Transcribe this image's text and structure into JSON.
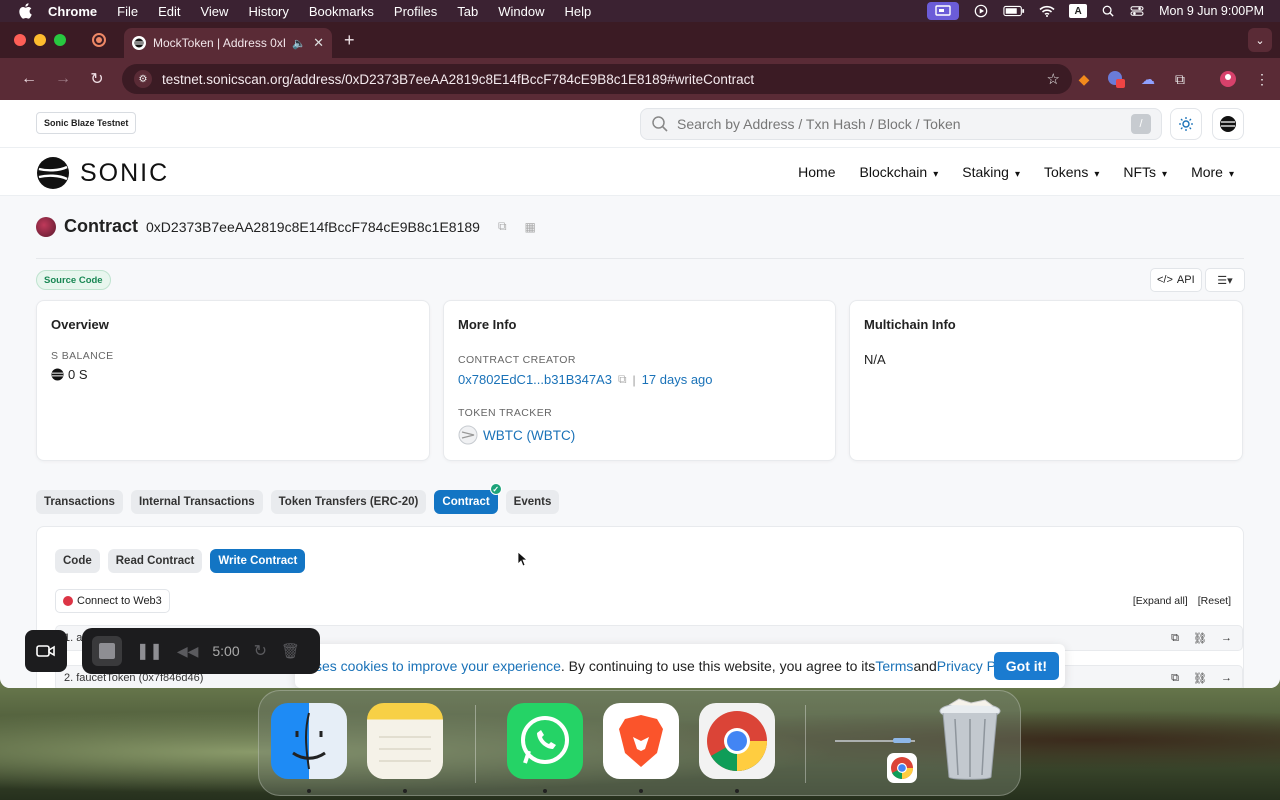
{
  "menubar": {
    "app": "Chrome",
    "items": [
      "File",
      "Edit",
      "View",
      "History",
      "Bookmarks",
      "Profiles",
      "Tab",
      "Window",
      "Help"
    ],
    "clock": "Mon 9 Jun  9:00PM",
    "input_source": "A"
  },
  "browser": {
    "tab_title": "MockToken | Address 0xD",
    "url": "testnet.sonicscan.org/address/0xD2373B7eeAA2819c8E14fBccF784cE9B8c1E8189#writeContract",
    "ext_badge": "1"
  },
  "site": {
    "network_badge": "Sonic Blaze Testnet",
    "search_placeholder": "Search by Address / Txn Hash / Block / Token",
    "search_shortcut": "/",
    "logo_text": "SONIC",
    "nav": [
      "Home",
      "Blockchain",
      "Staking",
      "Tokens",
      "NFTs",
      "More"
    ]
  },
  "contract": {
    "label": "Contract",
    "address": "0xD2373B7eeAA2819c8E14fBccF784cE9B8c1E8189",
    "source_badge": "Source Code",
    "api_label": "API"
  },
  "overview": {
    "title": "Overview",
    "balance_label": "S BALANCE",
    "balance_value": "0 S"
  },
  "more_info": {
    "title": "More Info",
    "creator_label": "CONTRACT CREATOR",
    "creator_addr": "0x7802EdC1...b31B347A3",
    "separator": "|",
    "creator_age": "17 days ago",
    "tracker_label": "TOKEN TRACKER",
    "tracker_value": "WBTC (WBTC)"
  },
  "multichain": {
    "title": "Multichain Info",
    "value": "N/A"
  },
  "tabs": [
    "Transactions",
    "Internal Transactions",
    "Token Transfers (ERC-20)",
    "Contract",
    "Events"
  ],
  "subtabs": [
    "Code",
    "Read Contract",
    "Write Contract"
  ],
  "write": {
    "connect_label": "Connect to Web3",
    "expand_all": "[Expand all]",
    "reset": "[Reset]",
    "row1_prefix": "1. a",
    "row2": "2. faucetToken (0x7f846d46)"
  },
  "cookie": {
    "text_1": "ses cookies to improve your experience",
    "text_2": ". By continuing to use this website, you agree to its ",
    "terms": "Terms",
    "and": " and ",
    "privacy": "Privacy Policy",
    "dot": ".",
    "button": "Got it!"
  },
  "recorder": {
    "time": "5:00"
  },
  "dock": {
    "apps": [
      "Finder",
      "Notes",
      "WhatsApp",
      "Brave",
      "Chrome",
      "Trash"
    ]
  }
}
